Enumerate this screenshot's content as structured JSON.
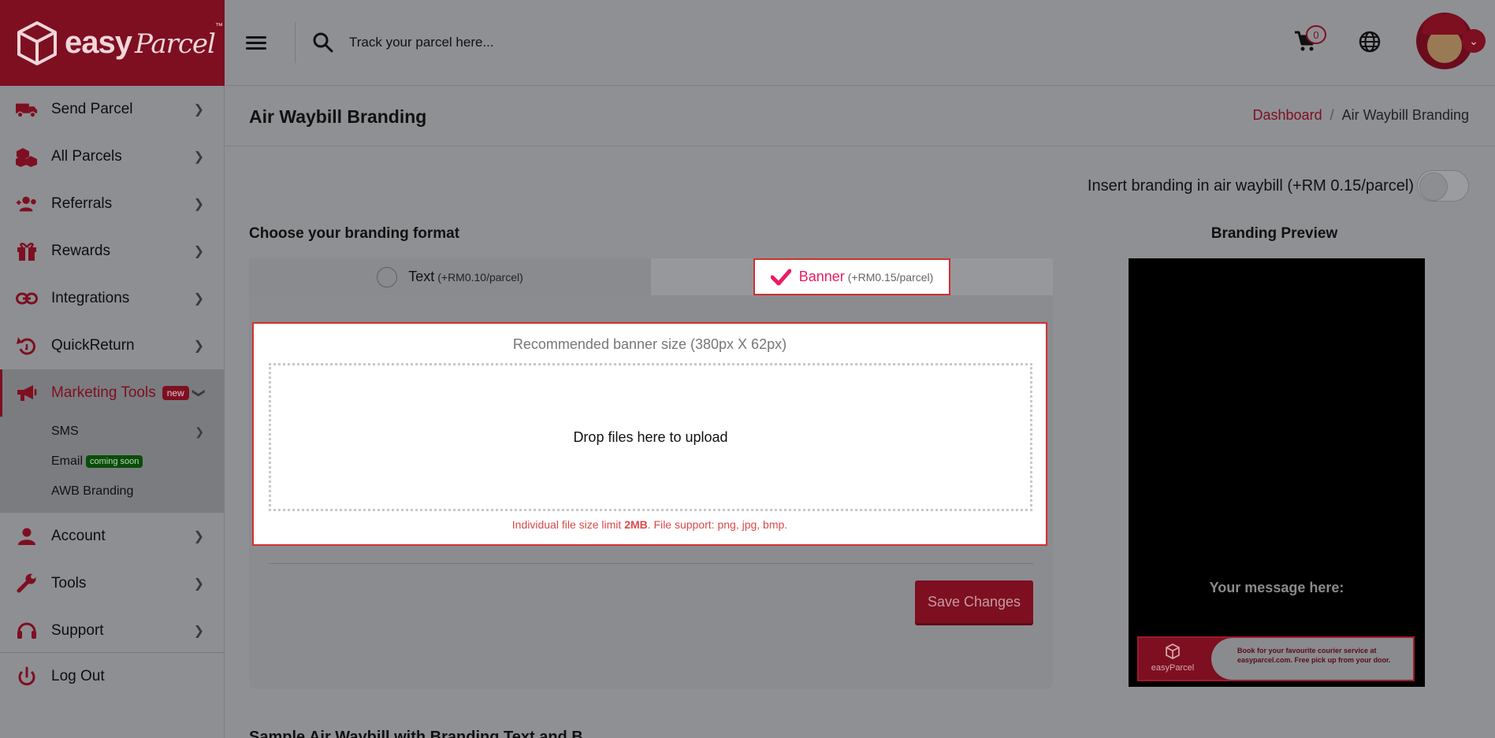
{
  "brand": {
    "name": "easy",
    "script": "Parcel",
    "tm": "™"
  },
  "topbar": {
    "search_placeholder": "Track your parcel here...",
    "cart_count": "0"
  },
  "sidebar": {
    "items": [
      {
        "label": "Send Parcel",
        "icon": "truck-icon"
      },
      {
        "label": "All Parcels",
        "icon": "boxes-icon"
      },
      {
        "label": "Referrals",
        "icon": "users-plus-icon"
      },
      {
        "label": "Rewards",
        "icon": "gift-icon"
      },
      {
        "label": "Integrations",
        "icon": "link-icon"
      },
      {
        "label": "QuickReturn",
        "icon": "return-icon"
      },
      {
        "label": "Marketing Tools",
        "icon": "megaphone-icon",
        "badge": "new"
      }
    ],
    "sub_items": [
      {
        "label": "SMS"
      },
      {
        "label": "Email",
        "badge": "coming soon"
      },
      {
        "label": "AWB Branding"
      }
    ],
    "items_after": [
      {
        "label": "Account",
        "icon": "person-icon"
      },
      {
        "label": "Tools",
        "icon": "wrench-icon"
      },
      {
        "label": "Support",
        "icon": "headset-icon"
      }
    ],
    "logout": "Log Out"
  },
  "page": {
    "title": "Air Waybill Branding",
    "breadcrumb": {
      "home": "Dashboard",
      "separator": "/",
      "current": "Air Waybill Branding"
    }
  },
  "branding": {
    "toggle_label": "Insert branding in air waybill (+RM 0.15/parcel)",
    "toggle_on": false,
    "choose_label": "Choose your branding format",
    "tab_text_label": "Text",
    "tab_text_price": "(+RM0.10/parcel)",
    "tab_banner_label": "Banner",
    "tab_banner_price": "(+RM0.15/parcel)",
    "selected": "Banner",
    "recommended_size": "Recommended banner size (380px X 62px)",
    "drop_text": "Drop files here to upload",
    "limit_prefix": "Individual file size limit ",
    "limit_size": "2MB",
    "limit_suffix": ". File support: png, jpg, bmp.",
    "save_label": "Save Changes"
  },
  "preview": {
    "title": "Branding Preview",
    "message": "Your message here:",
    "banner_logo": "easyParcel",
    "banner_text": "Book for your favourite courier service at easyparcel.com. Free pick up from your door."
  },
  "bottom_peek": "Sample Air Waybill with Branding Text and B",
  "colors": {
    "brand": "#c8102e",
    "accent_pink": "#e91e63",
    "error_red": "#d32f2f"
  }
}
